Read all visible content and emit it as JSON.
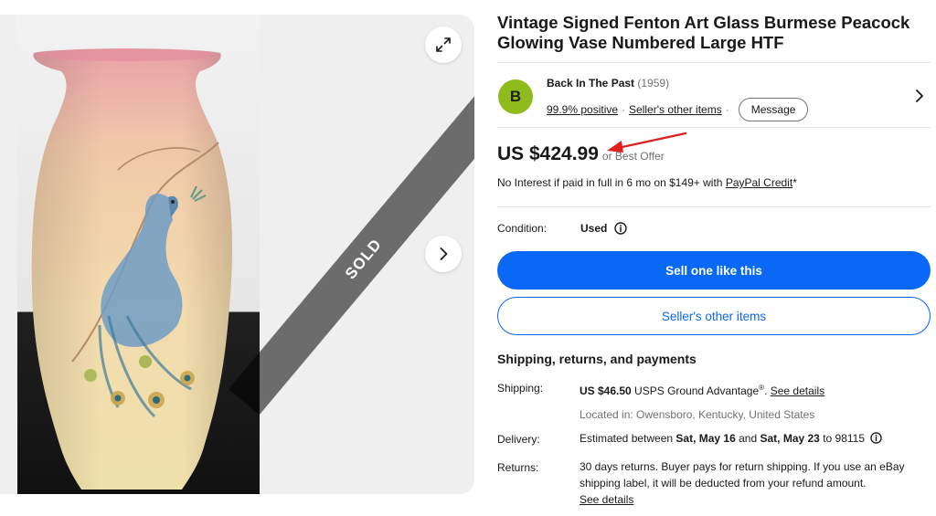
{
  "gallery": {
    "sold_label": "SOLD",
    "expand_icon": "expand-icon",
    "next_icon": "chevron-right-icon"
  },
  "listing": {
    "title": "Vintage Signed Fenton Art Glass Burmese Peacock Glowing Vase Numbered Large HTF"
  },
  "seller": {
    "avatar_letter": "B",
    "avatar_color": "#8fbc1c",
    "name": "Back In The Past",
    "feedback_count": "(1959)",
    "positive": "99.9% positive",
    "other_items_link": "Seller's other items",
    "message_button": "Message"
  },
  "price": {
    "amount": "US $424.99",
    "best_offer": "or Best Offer",
    "credit_text": "No Interest if paid in full in 6 mo on $149+ with ",
    "credit_link": "PayPal Credit",
    "credit_suffix": "*"
  },
  "condition": {
    "label": "Condition:",
    "value": "Used"
  },
  "actions": {
    "primary": "Sell one like this",
    "secondary": "Seller's other items",
    "primary_color": "#0968f6"
  },
  "shipping": {
    "section_title": "Shipping, returns, and payments",
    "shipping_label": "Shipping:",
    "shipping_cost": "US $46.50",
    "shipping_service": " USPS Ground Advantage",
    "shipping_trademark": "®",
    "shipping_link": "See details",
    "location": "Located in: Owensboro, Kentucky, United States",
    "delivery_label": "Delivery:",
    "delivery_prefix": "Estimated between ",
    "delivery_start": "Sat, May 16",
    "delivery_and": " and ",
    "delivery_end": "Sat, May 23",
    "delivery_to": " to 98115",
    "returns_label": "Returns:",
    "returns_text": "30 days returns. Buyer pays for return shipping. If you use an eBay shipping label, it will be deducted from your refund amount.",
    "returns_link": "See details"
  }
}
